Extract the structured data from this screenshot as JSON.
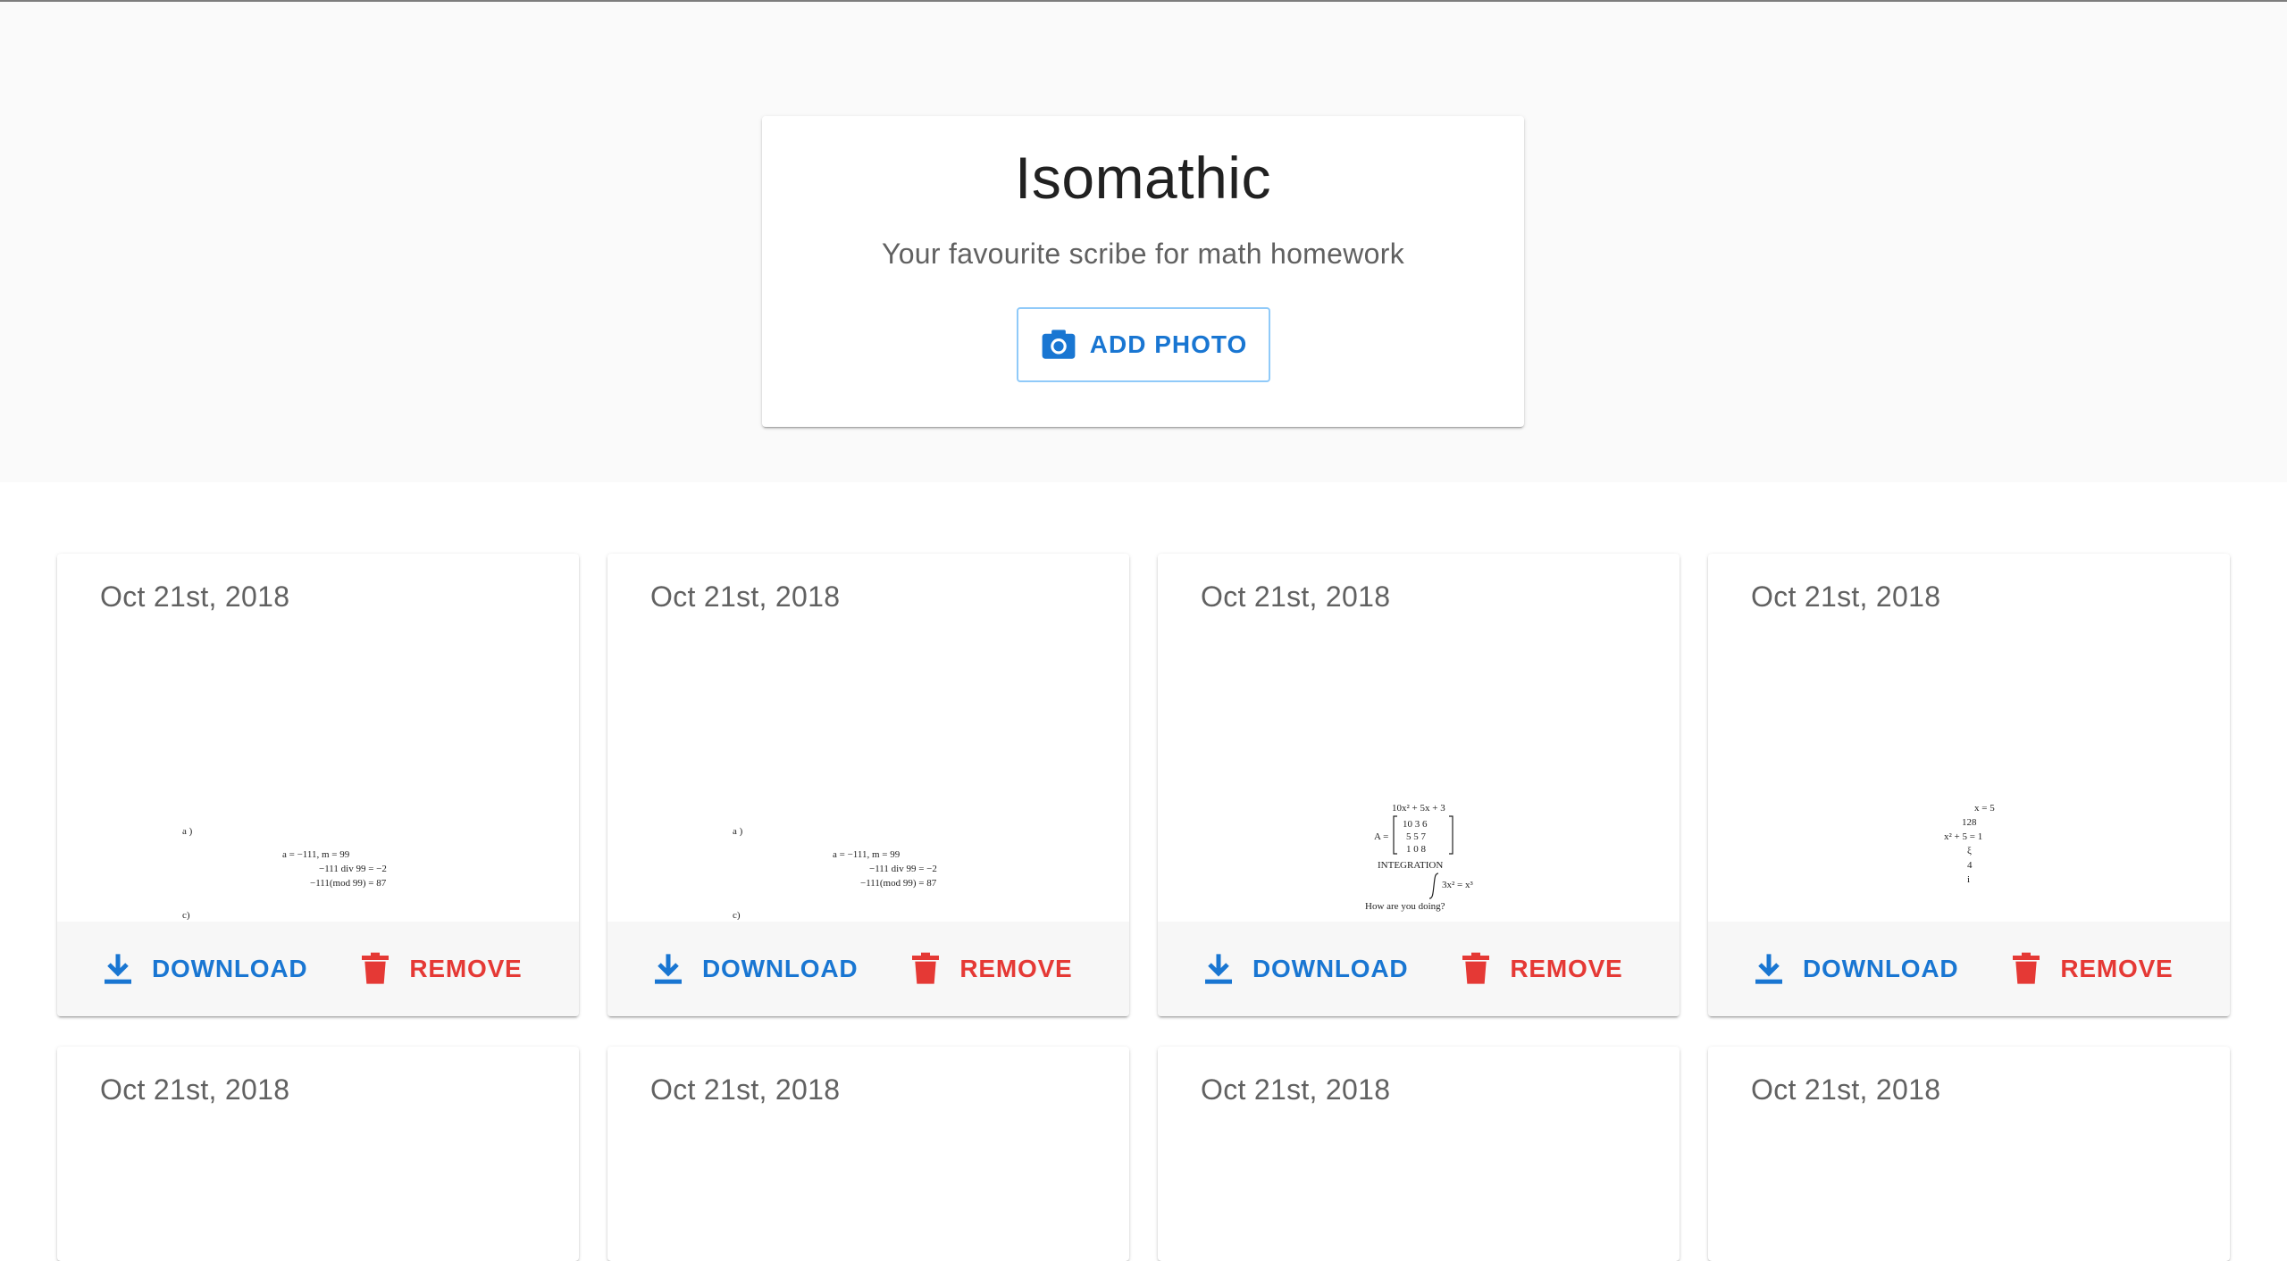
{
  "hero": {
    "title": "Isomathic",
    "subtitle": "Your favourite scribe for math homework",
    "add_photo_label": "ADD PHOTO",
    "add_photo_icon": "camera-icon"
  },
  "colors": {
    "primary": "#1976d2",
    "danger": "#e53935",
    "hero_background": "#fafafa",
    "actions_background": "#f7f7f7"
  },
  "cards": [
    {
      "date": "Oct 21st, 2018",
      "download_label": "DOWNLOAD",
      "remove_label": "REMOVE",
      "math": {
        "label_a": "a )",
        "line1": "a = −111,    m = 99",
        "line2": "−111 div 99 = −2",
        "line3": "−111(mod 99) = 87",
        "label_c": "c)"
      }
    },
    {
      "date": "Oct 21st, 2018",
      "download_label": "DOWNLOAD",
      "remove_label": "REMOVE",
      "math": {
        "label_a": "a )",
        "line1": "a = −111,    m = 99",
        "line2": "−111 div 99 = −2",
        "line3": "−111(mod 99) = 87",
        "label_c": "c)"
      }
    },
    {
      "date": "Oct 21st, 2018",
      "download_label": "DOWNLOAD",
      "remove_label": "REMOVE",
      "math": {
        "line1": "10x² + 5x + 3",
        "matrix_label": "A =",
        "row1": "10   3   6",
        "row2": "5    5   7",
        "row3": "1    0   8",
        "line2": "INTEGRATION",
        "integral": "3x² = x³",
        "line3": "How are you doing?"
      }
    },
    {
      "date": "Oct 21st, 2018",
      "download_label": "DOWNLOAD",
      "remove_label": "REMOVE",
      "math": {
        "line1": "x = 5",
        "line2": "128",
        "line3": "x² + 5 = 1",
        "line4": "ξ",
        "line5": "4",
        "line6": "i"
      }
    }
  ],
  "partial_cards": [
    {
      "date": "Oct 21st, 2018"
    },
    {
      "date": "Oct 21st, 2018"
    },
    {
      "date": "Oct 21st, 2018"
    },
    {
      "date": "Oct 21st, 2018"
    }
  ]
}
